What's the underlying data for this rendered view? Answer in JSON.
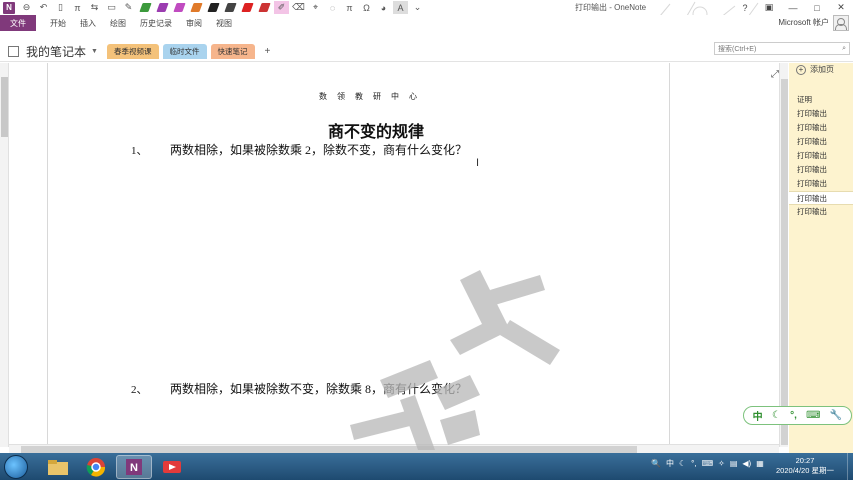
{
  "window": {
    "title": "打印输出 - OneNote",
    "account": "Microsoft 帐户"
  },
  "ribbon": {
    "file": "文件",
    "tabs": [
      "开始",
      "插入",
      "绘图",
      "历史记录",
      "审阅",
      "视图"
    ]
  },
  "notebook": {
    "name": "我的笔记本",
    "sections": [
      {
        "label": "春季视频课",
        "color": "#f4c27a"
      },
      {
        "label": "临时文件",
        "color": "#a9d3ee"
      },
      {
        "label": "快速笔记",
        "color": "#f6b58c"
      }
    ],
    "add_section": "+"
  },
  "search": {
    "placeholder": "搜索(Ctrl+E)"
  },
  "page": {
    "header": "数 领 教 研 中 心",
    "title": "商不变的规律",
    "questions": [
      {
        "num": "1、",
        "text": "两数相除，如果被除数乘 2，除数不变，商有什么变化？"
      },
      {
        "num": "2、",
        "text": "两数相除，如果被除数不变，除数乘 8，商有什么变化？"
      }
    ],
    "watermark": "教研"
  },
  "pages_pane": {
    "add_page": "添加页",
    "pages": [
      "证明",
      "打印输出",
      "打印输出",
      "打印输出",
      "打印输出",
      "打印输出",
      "打印输出",
      "打印输出",
      "打印输出"
    ],
    "active_index": 7
  },
  "ime": {
    "mode": "中"
  },
  "taskbar": {
    "tray_lang": "中",
    "time": "20:27",
    "date": "2020/4/20 星期一"
  },
  "colors": {
    "onenote_purple": "#80397b",
    "pages_pane_bg": "#fdf3cf",
    "ime_green": "#2f8f2f"
  }
}
